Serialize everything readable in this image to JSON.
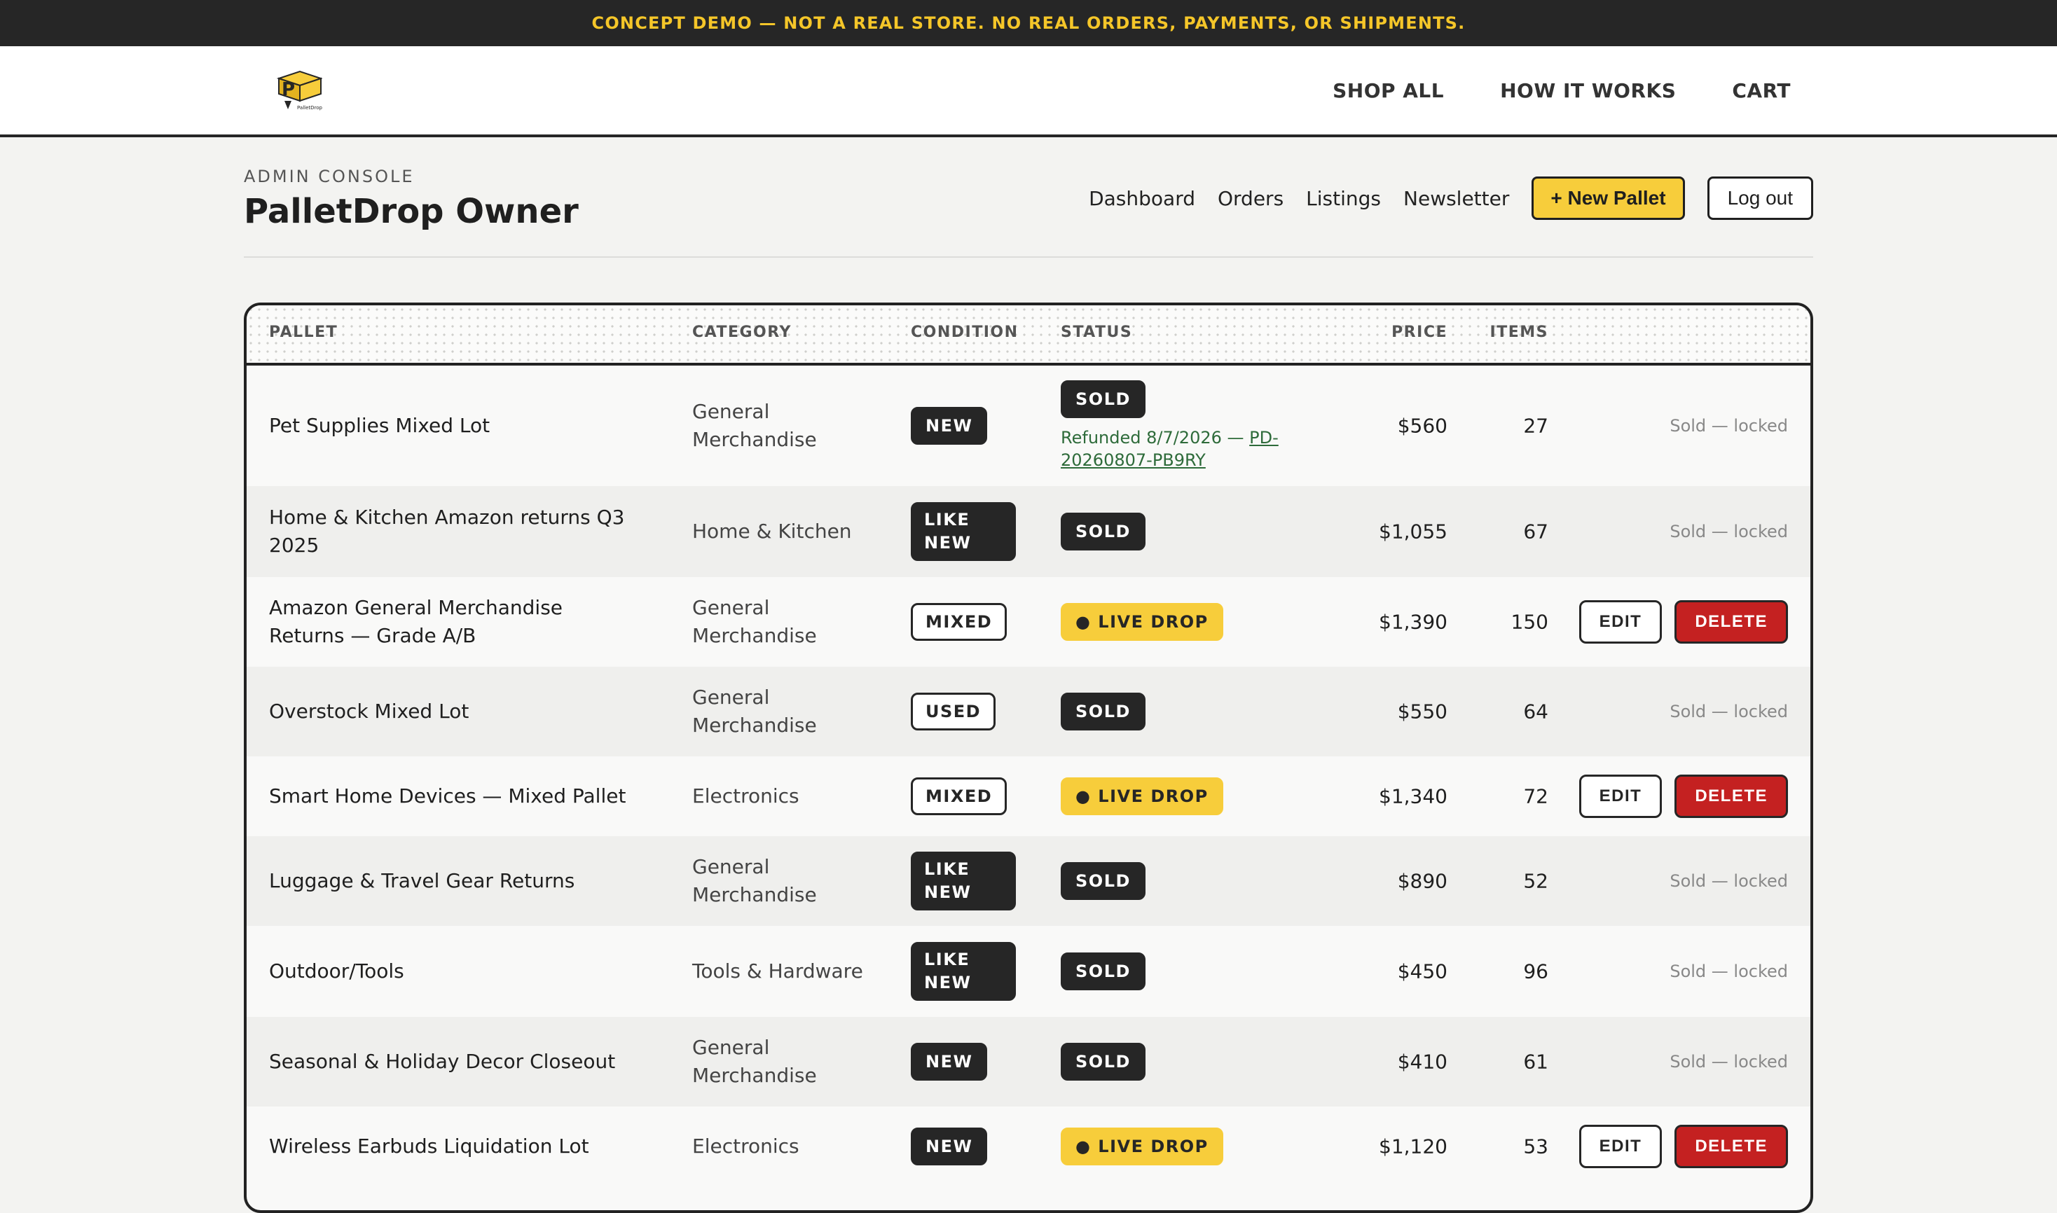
{
  "banner": {
    "text": "CONCEPT DEMO — NOT A REAL STORE. NO REAL ORDERS, PAYMENTS, OR SHIPMENTS."
  },
  "nav": {
    "shop_all": "SHOP ALL",
    "how_it_works": "HOW IT WORKS",
    "cart": "CART"
  },
  "logo": {
    "letter": "P",
    "tiny_text": "PalletDrop"
  },
  "admin": {
    "eyebrow": "ADMIN CONSOLE",
    "title": "PalletDrop Owner",
    "links": {
      "dashboard": "Dashboard",
      "orders": "Orders",
      "listings": "Listings",
      "newsletter": "Newsletter"
    },
    "new_pallet": "+ New Pallet",
    "logout": "Log out"
  },
  "table": {
    "headers": {
      "pallet": "PALLET",
      "category": "CATEGORY",
      "condition": "CONDITION",
      "status": "STATUS",
      "price": "PRICE",
      "items": "ITEMS"
    },
    "rows": [
      {
        "name": "Pet Supplies Mixed Lot",
        "category": "General Merchandise",
        "condition": "NEW",
        "status": "SOLD",
        "refund_prefix": "Refunded 8/7/2026 — ",
        "refund_link": "PD-20260807-PB9RY",
        "price": "$560",
        "items": "27",
        "action": "Sold — locked"
      },
      {
        "name": "Home & Kitchen Amazon returns Q3 2025",
        "category": "Home & Kitchen",
        "condition": "LIKE NEW",
        "status": "SOLD",
        "price": "$1,055",
        "items": "67",
        "action": "Sold — locked"
      },
      {
        "name": "Amazon General Merchandise Returns — Grade A/B",
        "category": "General Merchandise",
        "condition": "MIXED",
        "status": "LIVE DROP",
        "price": "$1,390",
        "items": "150",
        "edit": "EDIT",
        "delete": "DELETE"
      },
      {
        "name": "Overstock Mixed Lot",
        "category": "General Merchandise",
        "condition": "USED",
        "status": "SOLD",
        "price": "$550",
        "items": "64",
        "action": "Sold — locked"
      },
      {
        "name": "Smart Home Devices — Mixed Pallet",
        "category": "Electronics",
        "condition": "MIXED",
        "status": "LIVE DROP",
        "price": "$1,340",
        "items": "72",
        "edit": "EDIT",
        "delete": "DELETE"
      },
      {
        "name": "Luggage & Travel Gear Returns",
        "category": "General Merchandise",
        "condition": "LIKE NEW",
        "status": "SOLD",
        "price": "$890",
        "items": "52",
        "action": "Sold — locked"
      },
      {
        "name": "Outdoor/Tools",
        "category": "Tools & Hardware",
        "condition": "LIKE NEW",
        "status": "SOLD",
        "price": "$450",
        "items": "96",
        "action": "Sold — locked"
      },
      {
        "name": "Seasonal & Holiday Decor Closeout",
        "category": "General Merchandise",
        "condition": "NEW",
        "status": "SOLD",
        "price": "$410",
        "items": "61",
        "action": "Sold — locked"
      },
      {
        "name": "Wireless Earbuds Liquidation Lot",
        "category": "Electronics",
        "condition": "NEW",
        "status": "LIVE DROP",
        "price": "$1,120",
        "items": "53",
        "edit": "EDIT",
        "delete": "DELETE"
      }
    ]
  },
  "colors": {
    "accent": "#f7cd3b",
    "dark": "#262626",
    "danger": "#c42121",
    "refund": "#2e6b3a"
  }
}
